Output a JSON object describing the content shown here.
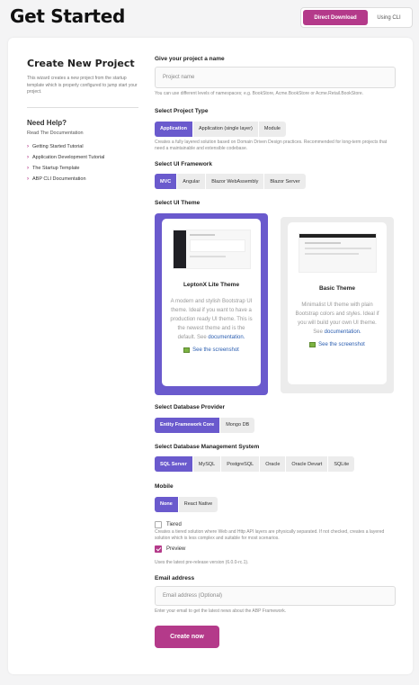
{
  "header": {
    "title": "Get Started",
    "mode_direct": "Direct Download",
    "mode_cli": "Using CLI"
  },
  "sidebar": {
    "heading": "Create New Project",
    "description": "This wizard creates a new project from the startup template which is properly configured to jump start your project.",
    "help_heading": "Need Help?",
    "docs_label": "Read The Documentation",
    "links": [
      "Getting Started Tutorial",
      "Application Development Tutorial",
      "The Startup Template",
      "ABP CLI Documentation"
    ]
  },
  "project_name": {
    "label": "Give your project a name",
    "placeholder": "Project name",
    "hint": "You can use different levels of namespaces; e.g. BookStore, Acme.BookStore or Acme.Retail.BookStore."
  },
  "project_type": {
    "label": "Select Project Type",
    "options": [
      "Application",
      "Application (single layer)",
      "Module"
    ],
    "hint": "Creates a fully layered solution based on Domain Driven Design practices. Recommended for long-term projects that need a maintainable and extensible codebase."
  },
  "ui_framework": {
    "label": "Select UI Framework",
    "options": [
      "MVC",
      "Angular",
      "Blazor WebAssembly",
      "Blazor Server"
    ]
  },
  "ui_theme": {
    "label": "Select UI Theme",
    "themes": [
      {
        "name": "LeptonX Lite Theme",
        "desc": "A modern and stylish Bootstrap UI theme. Ideal if you want to have a production ready UI theme. This is the newest theme and is the default. See",
        "docs": "documentation.",
        "link": "See the screenshot"
      },
      {
        "name": "Basic Theme",
        "desc": "Minimalist UI theme with plain Bootstrap colors and styles. Ideal if you will build your own UI theme. See",
        "docs": "documentation.",
        "link": "See the screenshot"
      }
    ]
  },
  "db_provider": {
    "label": "Select Database Provider",
    "options": [
      "Entity Framework Core",
      "Mongo DB"
    ]
  },
  "dbms": {
    "label": "Select Database Management System",
    "options": [
      "SQL Server",
      "MySQL",
      "PostgreSQL",
      "Oracle",
      "Oracle Devart",
      "SQLite"
    ]
  },
  "mobile": {
    "label": "Mobile",
    "options": [
      "None",
      "React Native"
    ]
  },
  "tiered": {
    "label": "Tiered",
    "hint": "Creates a tiered solution where Web and Http API layers are physically separated. If not checked, creates a layered solution which is less complex and suitable for most scenarios."
  },
  "preview": {
    "label": "Preview",
    "hint": "Uses the latest pre-release version (6.0.0-rc.1)."
  },
  "email": {
    "label": "Email address",
    "placeholder": "Email address (Optional)",
    "hint": "Enter your email to get the latest news about the ABP Framework."
  },
  "submit_label": "Create now",
  "colors": {
    "brand": "#b43a8a",
    "selected": "#6a5acd"
  }
}
